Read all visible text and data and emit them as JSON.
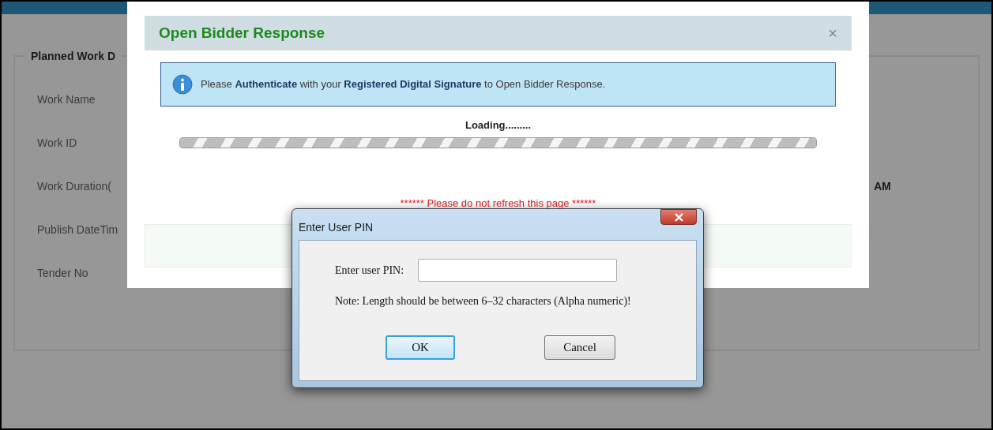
{
  "page": {
    "section_title": "Planned Work D",
    "fields": [
      {
        "label": "Work Name"
      },
      {
        "label": "Work ID"
      },
      {
        "label": "Work Duration(",
        "value": "AM"
      },
      {
        "label": "Publish DateTim"
      },
      {
        "label": "Tender No"
      }
    ]
  },
  "modal": {
    "title": "Open Bidder Response",
    "close": "×",
    "info": "Please **Authenticate** with your **Registered Digital Signature** to Open Bidder Response.",
    "loading": "Loading.........",
    "progress": {
      "level": 1
    },
    "warning": "****** Please do not refresh this page ******"
  },
  "dialog": {
    "title": "Enter User PIN",
    "field_label": "Enter user PIN:",
    "note": "Note: Length should be between 6–32 characters (Alpha numeric)!",
    "buttons": [
      {
        "label": "OK",
        "selected": true
      },
      {
        "label": "Cancel",
        "selected": false
      }
    ]
  }
}
